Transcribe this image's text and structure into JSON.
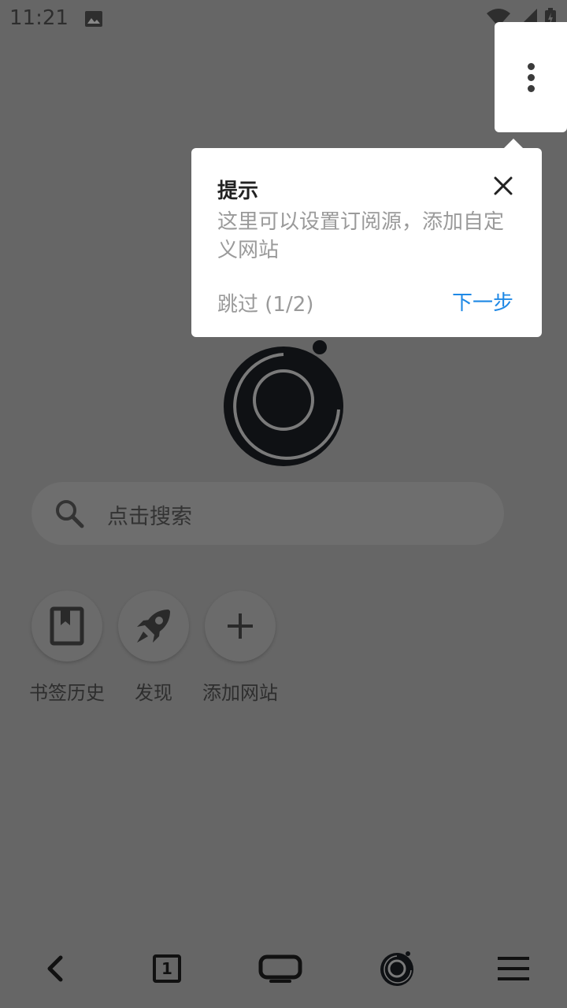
{
  "status_bar": {
    "time": "11:21",
    "icons": [
      "image-icon",
      "wifi-icon",
      "signal-icon",
      "battery-icon"
    ]
  },
  "toolbar": {
    "menu_icon": "more-vertical-icon"
  },
  "tip": {
    "title": "提示",
    "body": "这里可以设置订阅源，添加自定义网站",
    "skip": "跳过 (1/2)",
    "next": "下一步",
    "next_color": "#1e88e5"
  },
  "search": {
    "placeholder": "点击搜索"
  },
  "shortcuts": [
    {
      "label": "书签历史",
      "icon": "bookmark-icon"
    },
    {
      "label": "发现",
      "icon": "rocket-icon"
    },
    {
      "label": "添加网站",
      "icon": "plus-icon"
    }
  ],
  "bottom_nav": {
    "tab_count": "1",
    "items": [
      "back-icon",
      "tabs-icon",
      "tv-icon",
      "home-logo-icon",
      "menu-icon"
    ]
  },
  "colors": {
    "overlay_background": "#666666",
    "card_background": "#ffffff"
  }
}
